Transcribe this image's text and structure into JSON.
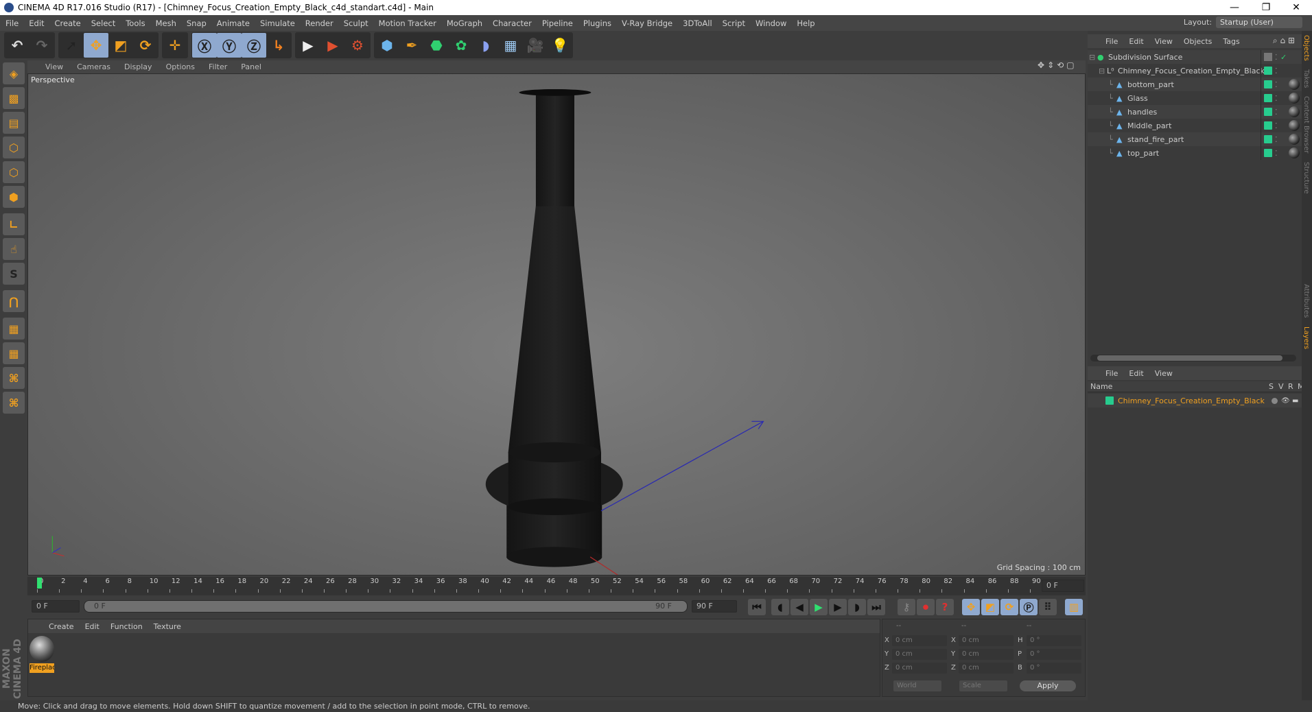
{
  "window": {
    "title": "CINEMA 4D R17.016 Studio (R17) - [Chimney_Focus_Creation_Empty_Black_c4d_standart.c4d] - Main",
    "minimize": "—",
    "restore": "❐",
    "close": "✕"
  },
  "menu": [
    "File",
    "Edit",
    "Create",
    "Select",
    "Tools",
    "Mesh",
    "Snap",
    "Animate",
    "Simulate",
    "Render",
    "Sculpt",
    "Motion Tracker",
    "MoGraph",
    "Character",
    "Pipeline",
    "Plugins",
    "V-Ray Bridge",
    "3DToAll",
    "Script",
    "Window",
    "Help"
  ],
  "layout": {
    "label": "Layout:",
    "value": "Startup (User)"
  },
  "toolbar": [
    [
      {
        "icon": "undo-icon",
        "glyph": "↶",
        "color": "#ddd"
      },
      {
        "icon": "redo-icon",
        "glyph": "↷",
        "color": "#666"
      }
    ],
    [
      {
        "icon": "select-icon",
        "glyph": "➚",
        "color": "#222",
        "active": false
      },
      {
        "icon": "move-icon",
        "glyph": "✥",
        "color": "#f0a020",
        "active": true
      },
      {
        "icon": "scale-icon",
        "glyph": "◩",
        "color": "#f0a020"
      },
      {
        "icon": "rotate-icon",
        "glyph": "⟳",
        "color": "#f0a020"
      }
    ],
    [
      {
        "icon": "move-alt-icon",
        "glyph": "✛",
        "color": "#f0a020"
      }
    ],
    [
      {
        "icon": "x-axis-icon",
        "glyph": "Ⓧ",
        "color": "#222",
        "active": true
      },
      {
        "icon": "y-axis-icon",
        "glyph": "Ⓨ",
        "color": "#222",
        "active": true
      },
      {
        "icon": "z-axis-icon",
        "glyph": "Ⓩ",
        "color": "#222",
        "active": true
      },
      {
        "icon": "coordinate-system-icon",
        "glyph": "↳",
        "color": "#f08020"
      }
    ],
    [
      {
        "icon": "render-view-icon",
        "glyph": "▶",
        "color": "#eee"
      },
      {
        "icon": "render-picture-viewer-icon",
        "glyph": "▶",
        "color": "#e05030"
      },
      {
        "icon": "render-settings-icon",
        "glyph": "⚙",
        "color": "#e05030"
      }
    ],
    [
      {
        "icon": "cube-icon",
        "glyph": "⬢",
        "color": "#6cb4ec"
      },
      {
        "icon": "pen-spline-icon",
        "glyph": "✒",
        "color": "#f0a020"
      },
      {
        "icon": "subdivision-icon",
        "glyph": "⬣",
        "color": "#30d070"
      },
      {
        "icon": "cloner-icon",
        "glyph": "✿",
        "color": "#30d070"
      },
      {
        "icon": "deformer-icon",
        "glyph": "◗",
        "color": "#8aa0f0"
      },
      {
        "icon": "floor-icon",
        "glyph": "▦",
        "color": "#9cc8f0"
      },
      {
        "icon": "camera-icon",
        "glyph": "🎥",
        "color": "#ddd"
      },
      {
        "icon": "light-icon",
        "glyph": "💡",
        "color": "#eee"
      }
    ]
  ],
  "left_toolbar": [
    {
      "icon": "model-mode-icon",
      "glyph": "◈"
    },
    {
      "icon": "texture-mode-icon",
      "glyph": "▩"
    },
    {
      "icon": "workplane-mode-icon",
      "glyph": "▤"
    },
    {
      "icon": "points-mode-icon",
      "glyph": "⬡"
    },
    {
      "icon": "edges-mode-icon",
      "glyph": "⬡"
    },
    {
      "icon": "polygons-mode-icon",
      "glyph": "⬢"
    },
    {
      "icon": "axis-mode-icon",
      "glyph": "∟"
    },
    {
      "icon": "tweak-mode-icon",
      "glyph": "☝"
    },
    {
      "icon": "snap-icon",
      "glyph": "S"
    },
    {
      "icon": "magnet-icon",
      "glyph": "⋂"
    },
    {
      "icon": "workplane-lock-icon",
      "glyph": "▦"
    },
    {
      "icon": "workplane-snap-icon",
      "glyph": "▦"
    },
    {
      "icon": "python-icon",
      "glyph": "⌘"
    },
    {
      "icon": "python-alt-icon",
      "glyph": "⌘"
    }
  ],
  "brand": "MAXON CINEMA 4D",
  "viewport": {
    "menu": [
      "View",
      "Cameras",
      "Display",
      "Options",
      "Filter",
      "Panel"
    ],
    "camera_label": "Perspective",
    "grid_spacing": "Grid Spacing : 100 cm",
    "nav_icons": [
      "✥",
      "⇕",
      "⟲",
      "▢"
    ]
  },
  "timeline": {
    "start": 0,
    "end": 90,
    "step": 2,
    "current_frame": "0 F",
    "start_field": "0 F",
    "range_start": "0 F",
    "range_end": "90 F",
    "end_field": "90 F"
  },
  "playback": [
    {
      "icon": "go-to-start-icon",
      "glyph": "⏮"
    },
    {
      "icon": "previous-key-icon",
      "glyph": "◖"
    },
    {
      "icon": "previous-frame-icon",
      "glyph": "◀"
    },
    {
      "icon": "play-icon",
      "glyph": "▶",
      "color": "#30e070"
    },
    {
      "icon": "next-frame-icon",
      "glyph": "▶"
    },
    {
      "icon": "next-key-icon",
      "glyph": "◗"
    },
    {
      "icon": "go-to-end-icon",
      "glyph": "⏭"
    },
    {
      "icon": "keyframe-lock-icon",
      "glyph": "⚷",
      "color": "#888"
    },
    {
      "icon": "record-icon",
      "glyph": "⏺",
      "color": "#e03030"
    },
    {
      "icon": "autokey-icon",
      "glyph": "?",
      "color": "#e03030"
    },
    {
      "icon": "key-position-icon",
      "glyph": "✥",
      "color": "#f0a020",
      "active": true
    },
    {
      "icon": "key-scale-icon",
      "glyph": "◩",
      "color": "#f0a020",
      "active": true
    },
    {
      "icon": "key-rotation-icon",
      "glyph": "⟳",
      "color": "#f0a020",
      "active": true
    },
    {
      "icon": "key-param-icon",
      "glyph": "Ⓟ",
      "color": "#222",
      "active": true
    },
    {
      "icon": "key-pla-icon",
      "glyph": "⠿",
      "color": "#222"
    },
    {
      "icon": "timeline-window-icon",
      "glyph": "▥",
      "color": "#f0a020",
      "active": true
    }
  ],
  "materials": {
    "menu": [
      "Create",
      "Edit",
      "Function",
      "Texture"
    ],
    "items": [
      {
        "name": "Fireplac"
      }
    ]
  },
  "coordinates": {
    "headers": [
      "--",
      "--",
      "--"
    ],
    "rows": [
      {
        "a": "X",
        "av": "0 cm",
        "b": "X",
        "bv": "0 cm",
        "c": "H",
        "cv": "0 °"
      },
      {
        "a": "Y",
        "av": "0 cm",
        "b": "Y",
        "bv": "0 cm",
        "c": "P",
        "cv": "0 °"
      },
      {
        "a": "Z",
        "av": "0 cm",
        "b": "Z",
        "bv": "0 cm",
        "c": "B",
        "cv": "0 °"
      }
    ],
    "mode": "World",
    "transform": "Scale",
    "apply": "Apply"
  },
  "status": "Move: Click and drag to move elements. Hold down SHIFT to quantize movement / add to the selection in point mode, CTRL to remove.",
  "objects": {
    "menu": [
      "File",
      "Edit",
      "View",
      "Objects",
      "Tags"
    ],
    "items": [
      {
        "name": "Subdivision Surface",
        "depth": 0,
        "type": "subdivision"
      },
      {
        "name": "Chimney_Focus_Creation_Empty_Black",
        "depth": 1,
        "type": "null"
      },
      {
        "name": "bottom_part",
        "depth": 2,
        "type": "mesh"
      },
      {
        "name": "Glass",
        "depth": 2,
        "type": "mesh"
      },
      {
        "name": "handles",
        "depth": 2,
        "type": "mesh"
      },
      {
        "name": "Middle_part",
        "depth": 2,
        "type": "mesh"
      },
      {
        "name": "stand_fire_part",
        "depth": 2,
        "type": "mesh"
      },
      {
        "name": "top_part",
        "depth": 2,
        "type": "mesh"
      }
    ]
  },
  "layers": {
    "menu": [
      "File",
      "Edit",
      "View"
    ],
    "columns": [
      "Name",
      "S",
      "V",
      "R",
      "M"
    ],
    "items": [
      {
        "name": "Chimney_Focus_Creation_Empty_Black",
        "color": "#27cc8e"
      }
    ]
  },
  "side_tabs": [
    "Objects",
    "Takes",
    "Content Browser",
    "Structure",
    "Attributes",
    "Layers"
  ],
  "colors": {
    "accent": "#f0a020",
    "layer_green": "#27cc8e",
    "active_button": "#8fa9cf"
  }
}
